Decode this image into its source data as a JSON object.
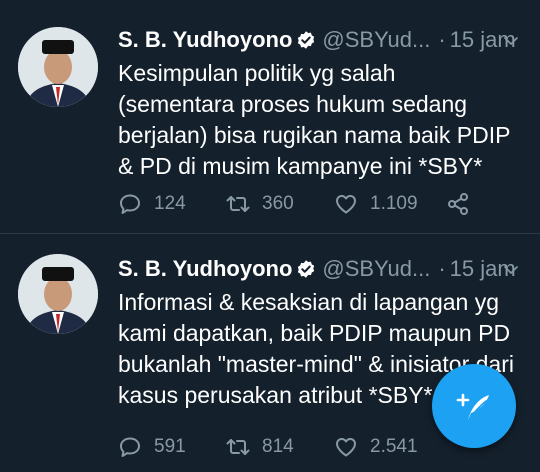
{
  "tweets": [
    {
      "display_name": "S. B. Yudhoyono",
      "handle": "@SBYud...",
      "separator": "·",
      "time": "15 jam",
      "text": "Kesimpulan politik yg salah (sementara proses hukum sedang berjalan) bisa rugikan nama baik PDIP & PD di musim kampanye ini *SBY*",
      "reply_count": "124",
      "retweet_count": "360",
      "like_count": "1.109"
    },
    {
      "display_name": "S. B. Yudhoyono",
      "handle": "@SBYud...",
      "separator": "·",
      "time": "15 jam",
      "text": "Informasi & kesaksian di lapangan yg kami dapatkan, baik PDIP maupun PD bukanlah \"master-mind\" & inisiator dari kasus perusakan atribut *SBY*",
      "reply_count": "591",
      "retweet_count": "814",
      "like_count": "2.541"
    }
  ],
  "icons": {
    "verified": "verified-badge-icon",
    "caret": "chevron-down-icon",
    "reply": "reply-icon",
    "retweet": "retweet-icon",
    "like": "heart-icon",
    "share": "share-icon",
    "compose": "compose-tweet-icon"
  },
  "colors": {
    "background": "#14202c",
    "divider": "#2b3a48",
    "muted": "#8899a6",
    "accent": "#1da1f2"
  }
}
